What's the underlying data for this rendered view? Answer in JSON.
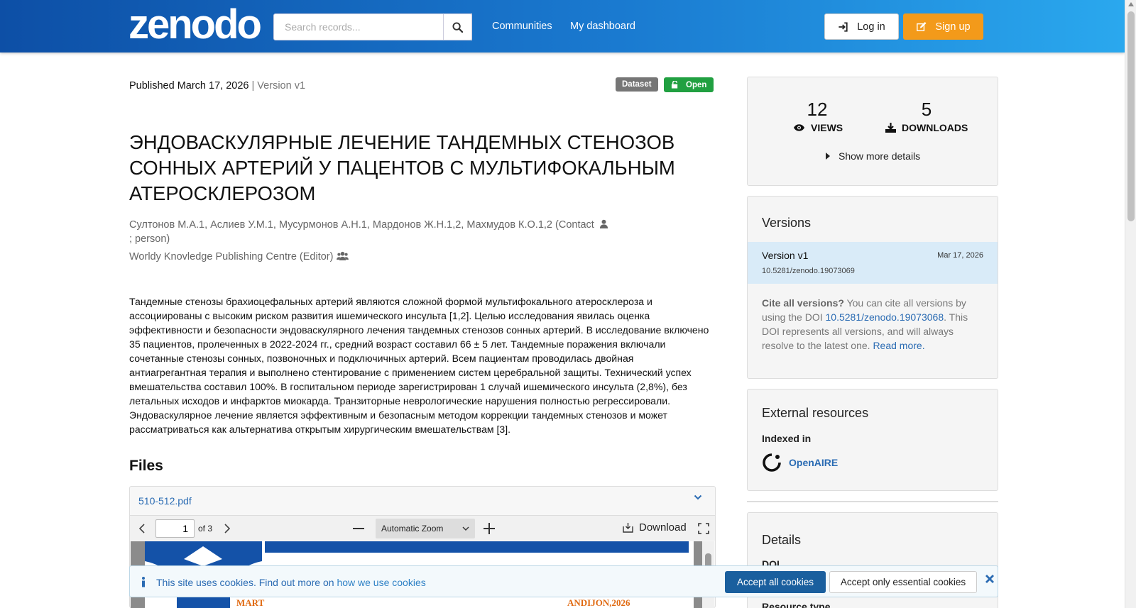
{
  "header": {
    "logo": "zenodo",
    "search_placeholder": "Search records...",
    "nav": [
      "Communities",
      "My dashboard"
    ],
    "login_label": "Log in",
    "signup_label": "Sign up"
  },
  "record": {
    "published": "Published March 17, 2026",
    "version": "| Version v1",
    "badge_type": "Dataset",
    "badge_access": "Open",
    "title": "ЭНДОВАСКУЛЯРНЫЕ ЛЕЧЕНИЕ ТАНДЕМНЫХ СТЕНОЗОВ СОННЫХ АРТЕРИЙ У ПАЦЕНТОВ С МУЛЬТИФОКАЛЬНЫМ АТЕРОСКЛЕРОЗОМ",
    "authors": "Султонов М.А.1, Аслиев У.М.1, Мусурмонов А.Н.1, Мардонов Ж.Н.1,2, Махмудов К.О.1,2 (Contact",
    "authors_tail": "; person)",
    "editor": "Worldy Knovledge Publishing Centre (Editor)",
    "abstract": "Тандемные стенозы брахиоцефальных артерий являются сложной формой мультифокального атеросклероза и ассоциированы с высоким риском развития ишемического инсульта [1,2]. Целью исследования явилась оценка эффективности и безопасности эндоваскулярного лечения тандемных стенозов сонных артерий. В исследование включено 35 пациентов, пролеченных в 2022-2024 гг., средний возраст составил 66 ± 5 лет. Тандемные поражения включали сочетанные стенозы сонных, позвоночных и подключичных артерий. Всем пациентам проводилась двойная антиагрегантная терапия и выполнено стентирование с применением систем церебральной защиты. Технический успех вмешательства составил 100%. В госпитальном периоде зарегистрирован 1 случай ишемического инсульта (2,8%), без летальных исходов и инфарктов миокарда. Транзиторные неврологические нарушения полностью регрессировали. Эндоваскулярное лечение является эффективным и безопасным методом коррекции тандемных стенозов и может рассматриваться как альтернатива открытым хирургическим вмешательствам [3]."
  },
  "files": {
    "heading": "Files",
    "file_name": "510-512.pdf",
    "page_value": "1",
    "page_of": "of 3",
    "zoom": "Automatic Zoom",
    "download_label": "Download",
    "preview_left": "MART",
    "preview_right": "ANDIJON,2026"
  },
  "stats": {
    "views": "12",
    "views_label": "VIEWS",
    "downloads": "5",
    "downloads_label": "DOWNLOADS",
    "more": "Show more details"
  },
  "versions": {
    "heading": "Versions",
    "current_label": "Version v1",
    "current_date": "Mar 17, 2026",
    "current_doi": "10.5281/zenodo.19073069",
    "cite_bold": "Cite all versions?",
    "cite_text1": "You can cite all versions by using the DOI",
    "cite_doi": "10.5281/zenodo.19073068",
    "cite_text2": ". This DOI represents all versions, and will always resolve to the latest one.",
    "read_more": "Read more."
  },
  "external": {
    "heading": "External resources",
    "indexed_in": "Indexed in",
    "openaire": "OpenAIRE"
  },
  "details": {
    "heading": "Details",
    "doi_label": "DOI",
    "resource_type_label": "Resource type"
  },
  "cookie": {
    "text": "This site uses cookies. Find out more on",
    "link": "how we use cookies",
    "accept_all": "Accept all cookies",
    "accept_essential": "Accept only essential cookies"
  },
  "colors": {
    "header_start": "#0d4fa6",
    "header_end": "#2aa8ee",
    "signup": "#f39a1a",
    "open_badge": "#21a041",
    "link": "#2a6bb3"
  }
}
